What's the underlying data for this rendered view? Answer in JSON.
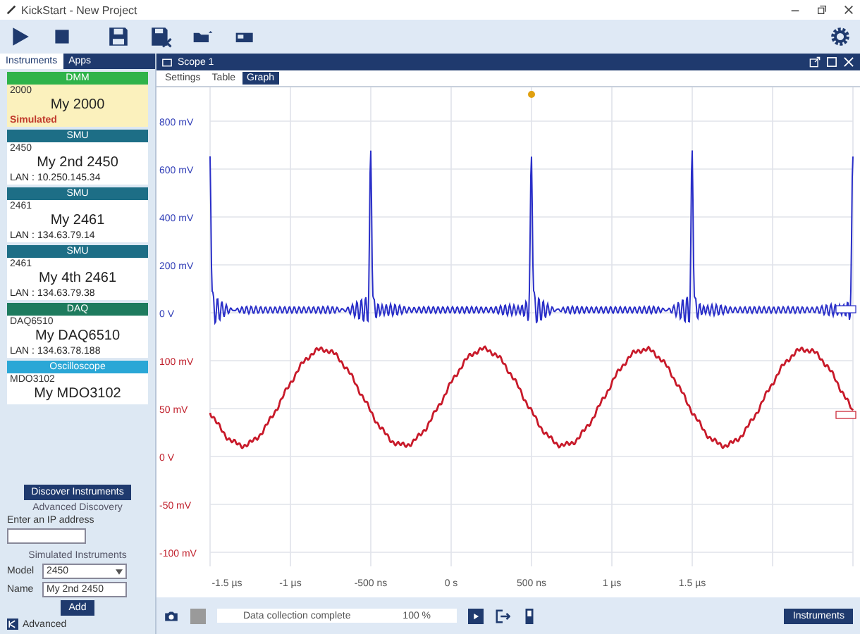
{
  "window": {
    "title": "KickStart - New Project"
  },
  "sidebar": {
    "tabs": [
      {
        "label": "Instruments",
        "selected": true
      },
      {
        "label": "Apps",
        "selected": false
      }
    ],
    "instruments": [
      {
        "kind": "simulated",
        "header": "DMM",
        "color": "#2fb34a",
        "model": "2000",
        "name": "My 2000",
        "connection": "Simulated",
        "selected": true
      },
      {
        "kind": "lan",
        "header": "SMU",
        "color": "#1d6e86",
        "model": "2450",
        "name": "My 2nd 2450",
        "connection": "LAN : 10.250.145.34",
        "selected": false
      },
      {
        "kind": "lan",
        "header": "SMU",
        "color": "#1d6e86",
        "model": "2461",
        "name": "My 2461",
        "connection": "LAN : 134.63.79.14",
        "selected": false
      },
      {
        "kind": "lan",
        "header": "SMU",
        "color": "#1d6e86",
        "model": "2461",
        "name": "My 4th 2461",
        "connection": "LAN : 134.63.79.38",
        "selected": false
      },
      {
        "kind": "lan",
        "header": "DAQ",
        "color": "#1e7b5e",
        "model": "DAQ6510",
        "name": "My DAQ6510",
        "connection": "LAN : 134.63.78.188",
        "selected": false
      },
      {
        "kind": "lan",
        "header": "Oscilloscope",
        "color": "#2aa7d6",
        "model": "MDO3102",
        "name": "My MDO3102",
        "selected": false
      }
    ],
    "discover_button": "Discover Instruments",
    "advanced_discovery": "Advanced Discovery",
    "ip_label": "Enter an IP address",
    "simulated": {
      "title": "Simulated Instruments",
      "model_label": "Model",
      "model_value": "2450",
      "name_label": "Name",
      "name_value": "My 2nd 2450",
      "add_button": "Add"
    },
    "footer": "Advanced"
  },
  "scope": {
    "title": "Scope 1",
    "tabs": [
      {
        "label": "Settings",
        "selected": false
      },
      {
        "label": "Table",
        "selected": false
      },
      {
        "label": "Graph",
        "selected": true
      }
    ],
    "y_labels_blue": [
      "800 mV",
      "600 mV",
      "400 mV",
      "200 mV",
      "0 V"
    ],
    "y_labels_red": [
      "100 mV",
      "50 mV",
      "0 V",
      "-50 mV",
      "-100 mV"
    ],
    "x_labels": [
      "-1.5 µs",
      "-1 µs",
      "-500 ns",
      "0 s",
      "500 ns",
      "1 µs",
      "1.5 µs"
    ],
    "status": "Data collection complete",
    "progress": "100 %",
    "instruments_button": "Instruments"
  }
}
